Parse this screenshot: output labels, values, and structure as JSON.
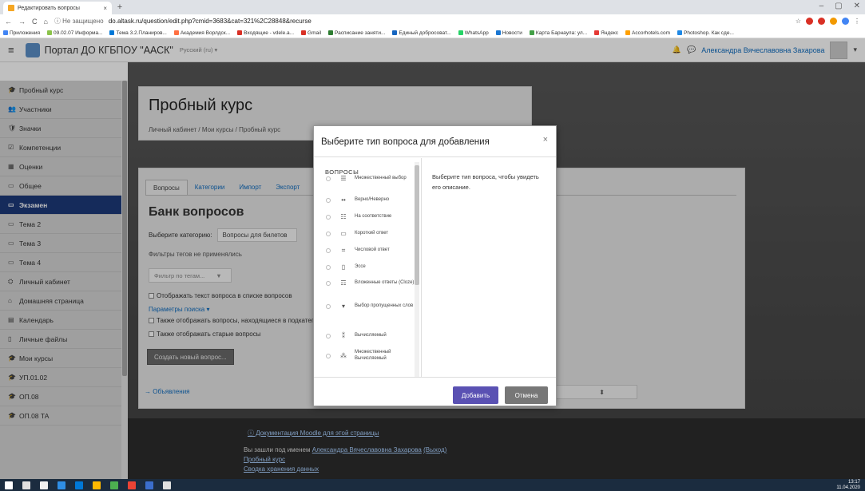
{
  "browser": {
    "tab_title": "Редактировать вопросы",
    "tab_close": "×",
    "new_tab": "+",
    "win_min": "–",
    "win_max": "▢",
    "win_close": "✕",
    "nav_back": "←",
    "nav_forward": "→",
    "nav_reload": "C",
    "nav_home": "⌂",
    "not_secure": "ⓘ Не защищено",
    "url": "do.altask.ru/question/edit.php?cmid=3683&cat=321%2C28848&recurse",
    "star": "☆",
    "menu": "⋮",
    "colors": {
      "red": "#d93025",
      "orange": "#f29900",
      "blue": "#4285f4"
    },
    "bookmarks": [
      {
        "label": "Приложения",
        "color": "#4285f4"
      },
      {
        "label": "09.02.07 Информа...",
        "color": "#8bc34a"
      },
      {
        "label": "Тема 3.2.Планиров...",
        "color": "#0078d7"
      },
      {
        "label": "Академия Ворлдск...",
        "color": "#ff7043"
      },
      {
        "label": "Входящие - vdele.a...",
        "color": "#d93025"
      },
      {
        "label": "Gmail",
        "color": "#d93025"
      },
      {
        "label": "Расписание заняти...",
        "color": "#2e7d32"
      },
      {
        "label": "Единый добросоват...",
        "color": "#1565c0"
      },
      {
        "label": "WhatsApp",
        "color": "#25d366"
      },
      {
        "label": "Новости",
        "color": "#1976d2"
      },
      {
        "label": "Карта Барнаула: ул...",
        "color": "#43a047"
      },
      {
        "label": "Яндекс",
        "color": "#e53935"
      },
      {
        "label": "Accorhotels.com",
        "color": "#ffa000"
      },
      {
        "label": "Photoshop. Как сде...",
        "color": "#1e88e5"
      }
    ]
  },
  "navbar": {
    "hamburger": "≡",
    "site_name": "Портал ДО КГБПОУ \"ААСК\"",
    "language": "Русский (ru) ▾",
    "bell": "🔔",
    "chat": "💬",
    "user_name": "Александра Вячеславовна Захарова",
    "user_menu": "▾"
  },
  "drawer": {
    "items": [
      {
        "icon": "🎓",
        "label": "Пробный курс",
        "active": false
      },
      {
        "icon": "👥",
        "label": "Участники",
        "active": false
      },
      {
        "icon": "🛡",
        "label": "Значки",
        "active": false
      },
      {
        "icon": "☑",
        "label": "Компетенции",
        "active": false
      },
      {
        "icon": "▦",
        "label": "Оценки",
        "active": false
      },
      {
        "icon": "▭",
        "label": "Общее",
        "active": false
      },
      {
        "icon": "▭",
        "label": "Экзамен",
        "active": true
      },
      {
        "icon": "▭",
        "label": "Тема 2",
        "active": false
      },
      {
        "icon": "▭",
        "label": "Тема 3",
        "active": false
      },
      {
        "icon": "▭",
        "label": "Тема 4",
        "active": false
      },
      {
        "icon": "⛭",
        "label": "Личный кабинет",
        "active": false
      },
      {
        "icon": "⌂",
        "label": "Домашняя страница",
        "active": false
      },
      {
        "icon": "▤",
        "label": "Календарь",
        "active": false
      },
      {
        "icon": "▯",
        "label": "Личные файлы",
        "active": false
      },
      {
        "icon": "🎓",
        "label": "Мои курсы",
        "active": false
      },
      {
        "icon": "🎓",
        "label": "УП.01.02",
        "active": false
      },
      {
        "icon": "🎓",
        "label": "ОП.08",
        "active": false
      },
      {
        "icon": "🎓",
        "label": "ОП.08 ТА",
        "active": false
      }
    ]
  },
  "header": {
    "title": "Пробный курс",
    "breadcrumb": "Личный кабинет / Мои курсы / Пробный курс"
  },
  "bank": {
    "tabs": [
      {
        "label": "Вопросы",
        "current": true
      },
      {
        "label": "Категории",
        "current": false
      },
      {
        "label": "Импорт",
        "current": false
      },
      {
        "label": "Экспорт",
        "current": false
      }
    ],
    "title": "Банк вопросов",
    "category_label": "Выберите категорию:",
    "category_value": "Вопросы для билетов",
    "tags_note": "Фильтры тегов не применялись",
    "tag_filter_placeholder": "Фильтр по тегам...",
    "tag_filter_arrow": "▼",
    "show_text": "Отображать текст вопроса в списке вопросов",
    "search_params": "Параметры поиска ▾",
    "show_subcats": "Также отображать вопросы, находящиеся в подкатегориях",
    "show_old": "Также отображать старые вопросы",
    "create_button": "Создать новый вопрос...",
    "announcements": "→ Объявления",
    "jump_arrow": "⬍"
  },
  "footer": {
    "doc_link": "ⓘ Документация Moodle для этой страницы",
    "login_prefix": "Вы зашли под именем",
    "login_name": "Александра Вячеславовна Захарова",
    "logout": "(Выход)",
    "course_link": "Пробный курс",
    "data_link": "Сводка хранения данных"
  },
  "modal": {
    "title": "Выберите тип вопроса для добавления",
    "close": "×",
    "section_heading": "ВОПРОСЫ",
    "description": "Выберите тип вопроса, чтобы увидеть его описание.",
    "add_button": "Добавить",
    "cancel_button": "Отмена",
    "question_types": [
      {
        "icon": "☰",
        "label": "Множественный выбор"
      },
      {
        "icon": "••",
        "label": "Верно/Неверно"
      },
      {
        "icon": "☷",
        "label": "На соответствие"
      },
      {
        "icon": "▭",
        "label": "Короткий ответ"
      },
      {
        "icon": "⌗",
        "label": "Числовой ответ"
      },
      {
        "icon": "▯",
        "label": "Эссе"
      },
      {
        "icon": "☶",
        "label": "Вложенные ответы (Cloze)"
      },
      {
        "icon": "▾",
        "label": "Выбор пропущенных слов"
      },
      {
        "icon": "⁑",
        "label": "Вычисляемый"
      },
      {
        "icon": "⁂",
        "label": "Множественный Вычисляемый"
      }
    ]
  },
  "taskbar": {
    "time": "13:17",
    "date": "11.04.2020",
    "apps": [
      "#ffffff",
      "#e0e0e0",
      "#f0f0f0",
      "#2f8ee4",
      "#0078d7",
      "#ffb900",
      "#4caf50",
      "#ea4335",
      "#3b6ecc",
      "#e0e0e0"
    ]
  }
}
